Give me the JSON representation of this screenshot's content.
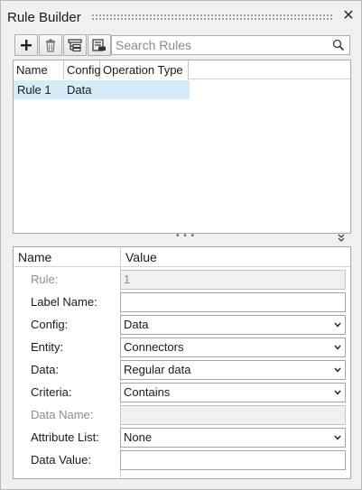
{
  "window": {
    "title": "Rule Builder"
  },
  "toolbar": {
    "buttons": [
      {
        "icon": "plus-icon",
        "tooltip": ""
      },
      {
        "icon": "trash-icon",
        "tooltip": ""
      },
      {
        "icon": "tree-icon",
        "tooltip": ""
      },
      {
        "icon": "report-icon",
        "tooltip": ""
      }
    ]
  },
  "search": {
    "placeholder": "Search Rules",
    "value": ""
  },
  "rules_table": {
    "columns": [
      "Name",
      "Config",
      "Operation Type"
    ],
    "rows": [
      {
        "name": "Rule 1",
        "config": "Data",
        "operation_type": "",
        "selected": true
      }
    ]
  },
  "properties": {
    "header": {
      "name": "Name",
      "value": "Value"
    },
    "rows": [
      {
        "label": "Rule:",
        "value": "1",
        "kind": "text",
        "disabled": true
      },
      {
        "label": "Label Name:",
        "value": "",
        "kind": "text",
        "disabled": false
      },
      {
        "label": "Config:",
        "value": "Data",
        "kind": "select",
        "disabled": false
      },
      {
        "label": "Entity:",
        "value": "Connectors",
        "kind": "select",
        "disabled": false
      },
      {
        "label": "Data:",
        "value": "Regular data",
        "kind": "select",
        "disabled": false
      },
      {
        "label": "Criteria:",
        "value": "Contains",
        "kind": "select",
        "disabled": false
      },
      {
        "label": "Data Name:",
        "value": "",
        "kind": "text",
        "disabled": true
      },
      {
        "label": "Attribute List:",
        "value": "None",
        "kind": "select",
        "disabled": false
      },
      {
        "label": "Data Value:",
        "value": "",
        "kind": "text",
        "disabled": false
      }
    ]
  },
  "colors": {
    "panel_bg": "#f0f0f0",
    "selected_row": "#d4ecfa",
    "disabled_text": "#8c8c8c",
    "border": "#a9a9a9"
  }
}
